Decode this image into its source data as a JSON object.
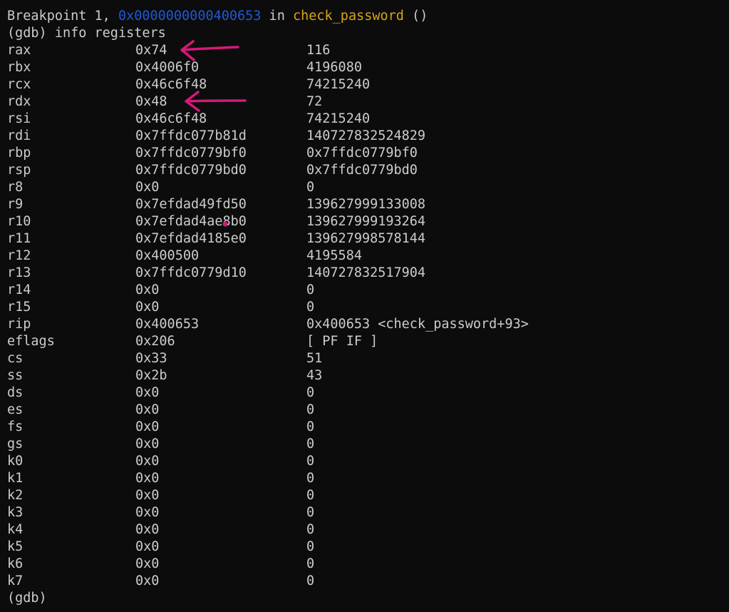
{
  "header": {
    "breakpoint_prefix": "Breakpoint 1, ",
    "breakpoint_addr": "0x0000000000400653",
    "in_word": " in ",
    "func_name": "check_password",
    "func_suffix": " ()"
  },
  "command": {
    "prompt": "(gdb)",
    "text": " info registers"
  },
  "registers": [
    {
      "name": "rax",
      "hex": "0x74",
      "value": "116"
    },
    {
      "name": "rbx",
      "hex": "0x4006f0",
      "value": "4196080"
    },
    {
      "name": "rcx",
      "hex": "0x46c6f48",
      "value": "74215240"
    },
    {
      "name": "rdx",
      "hex": "0x48",
      "value": "72"
    },
    {
      "name": "rsi",
      "hex": "0x46c6f48",
      "value": "74215240"
    },
    {
      "name": "rdi",
      "hex": "0x7ffdc077b81d",
      "value": "140727832524829"
    },
    {
      "name": "rbp",
      "hex": "0x7ffdc0779bf0",
      "value": "0x7ffdc0779bf0"
    },
    {
      "name": "rsp",
      "hex": "0x7ffdc0779bd0",
      "value": "0x7ffdc0779bd0"
    },
    {
      "name": "r8",
      "hex": "0x0",
      "value": "0"
    },
    {
      "name": "r9",
      "hex": "0x7efdad49fd50",
      "value": "139627999133008"
    },
    {
      "name": "r10",
      "hex": "0x7efdad4ae8b0",
      "value": "139627999193264"
    },
    {
      "name": "r11",
      "hex": "0x7efdad4185e0",
      "value": "139627998578144"
    },
    {
      "name": "r12",
      "hex": "0x400500",
      "value": "4195584"
    },
    {
      "name": "r13",
      "hex": "0x7ffdc0779d10",
      "value": "140727832517904"
    },
    {
      "name": "r14",
      "hex": "0x0",
      "value": "0"
    },
    {
      "name": "r15",
      "hex": "0x0",
      "value": "0"
    },
    {
      "name": "rip",
      "hex": "0x400653",
      "value": "0x400653 <check_password+93>"
    },
    {
      "name": "eflags",
      "hex": "0x206",
      "value": "[ PF IF ]"
    },
    {
      "name": "cs",
      "hex": "0x33",
      "value": "51"
    },
    {
      "name": "ss",
      "hex": "0x2b",
      "value": "43"
    },
    {
      "name": "ds",
      "hex": "0x0",
      "value": "0"
    },
    {
      "name": "es",
      "hex": "0x0",
      "value": "0"
    },
    {
      "name": "fs",
      "hex": "0x0",
      "value": "0"
    },
    {
      "name": "gs",
      "hex": "0x0",
      "value": "0"
    },
    {
      "name": "k0",
      "hex": "0x0",
      "value": "0"
    },
    {
      "name": "k1",
      "hex": "0x0",
      "value": "0"
    },
    {
      "name": "k2",
      "hex": "0x0",
      "value": "0"
    },
    {
      "name": "k3",
      "hex": "0x0",
      "value": "0"
    },
    {
      "name": "k4",
      "hex": "0x0",
      "value": "0"
    },
    {
      "name": "k5",
      "hex": "0x0",
      "value": "0"
    },
    {
      "name": "k6",
      "hex": "0x0",
      "value": "0"
    },
    {
      "name": "k7",
      "hex": "0x0",
      "value": "0"
    }
  ],
  "footer": {
    "prompt": "(gdb)"
  },
  "colors": {
    "background": "#0c0c0c",
    "text": "#cccccc",
    "address": "#1f57d6",
    "function": "#d8a513",
    "annotation": "#d6197a"
  },
  "annotations": [
    {
      "icon": "arrow-left-icon",
      "target": "rax"
    },
    {
      "icon": "arrow-left-icon",
      "target": "rdx"
    }
  ]
}
